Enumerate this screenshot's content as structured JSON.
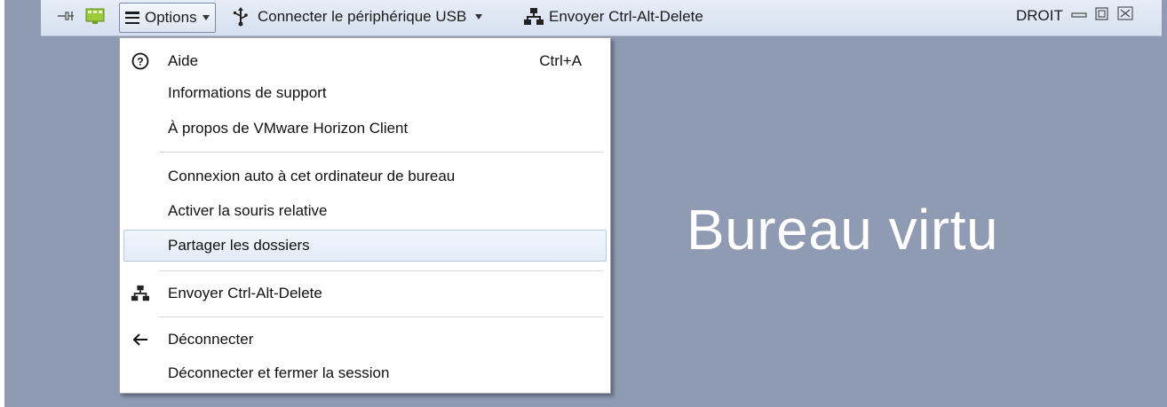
{
  "toolbar": {
    "options_label": "Options",
    "usb_label": "Connecter le périphérique USB",
    "send_cad_label": "Envoyer Ctrl-Alt-Delete",
    "display_mode": "DROIT"
  },
  "menu": {
    "items": [
      {
        "label": "Aide",
        "shortcut": "Ctrl+A",
        "icon": "help-icon"
      },
      {
        "label": "Informations de support"
      },
      {
        "label": "À propos de VMware Horizon Client"
      },
      {
        "label": "Connexion auto à cet ordinateur de bureau"
      },
      {
        "label": "Activer la souris relative"
      },
      {
        "label": "Partager les dossiers",
        "highlighted": true
      },
      {
        "label": "Envoyer Ctrl-Alt-Delete",
        "icon": "network-icon"
      },
      {
        "label": "Déconnecter",
        "icon": "back-arrow-icon"
      },
      {
        "label": "Déconnecter et fermer la session"
      }
    ]
  },
  "desktop": {
    "title": "Bureau virtu"
  },
  "colors": {
    "desktop_bg": "#8e9bb3",
    "toolbar_bg": "#dfe7f2",
    "menu_bg": "#ffffff"
  }
}
